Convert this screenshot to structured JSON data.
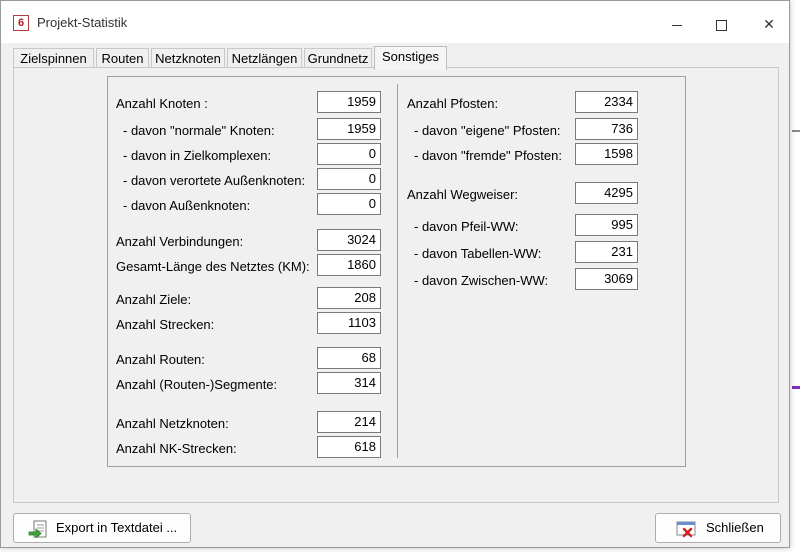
{
  "window": {
    "title": "Projekt-Statistik",
    "app_icon_glyph": "6"
  },
  "tabs": [
    {
      "label": "Zielspinnen"
    },
    {
      "label": "Routen"
    },
    {
      "label": "Netzknoten"
    },
    {
      "label": "Netzlängen"
    },
    {
      "label": "Grundnetz"
    },
    {
      "label": "Sonstiges",
      "active": true
    }
  ],
  "left": {
    "rows": [
      {
        "label": "Anzahl Knoten :",
        "value": "1959"
      },
      {
        "label": "- davon \"normale\" Knoten:",
        "value": "1959"
      },
      {
        "label": "- davon in Zielkomplexen:",
        "value": "0"
      },
      {
        "label": "- davon verortete Außenknoten:",
        "value": "0"
      },
      {
        "label": "- davon Außenknoten:",
        "value": "0"
      },
      {
        "label": "Anzahl Verbindungen:",
        "value": "3024"
      },
      {
        "label": "Gesamt-Länge des Netztes (KM):",
        "value": "1860"
      },
      {
        "label": "Anzahl Ziele:",
        "value": "208"
      },
      {
        "label": "Anzahl Strecken:",
        "value": "1103"
      },
      {
        "label": "Anzahl Routen:",
        "value": "68"
      },
      {
        "label": "Anzahl (Routen-)Segmente:",
        "value": "314"
      },
      {
        "label": "Anzahl Netzknoten:",
        "value": "214"
      },
      {
        "label": "Anzahl NK-Strecken:",
        "value": "618"
      }
    ]
  },
  "right": {
    "rows": [
      {
        "label": "Anzahl Pfosten:",
        "value": "2334"
      },
      {
        "label": "- davon \"eigene\" Pfosten:",
        "value": "736"
      },
      {
        "label": "- davon \"fremde\" Pfosten:",
        "value": "1598"
      },
      {
        "label": "Anzahl Wegweiser:",
        "value": "4295"
      },
      {
        "label": "- davon Pfeil-WW:",
        "value": "995"
      },
      {
        "label": "- davon Tabellen-WW:",
        "value": "231"
      },
      {
        "label": "- davon Zwischen-WW:",
        "value": "3069"
      }
    ]
  },
  "buttons": {
    "export_label": "Export in Textdatei  ...",
    "close_label": "Schließen"
  },
  "icons": {
    "app": "app-logo-icon",
    "export": "export-file-icon",
    "close": "close-dialog-icon"
  }
}
